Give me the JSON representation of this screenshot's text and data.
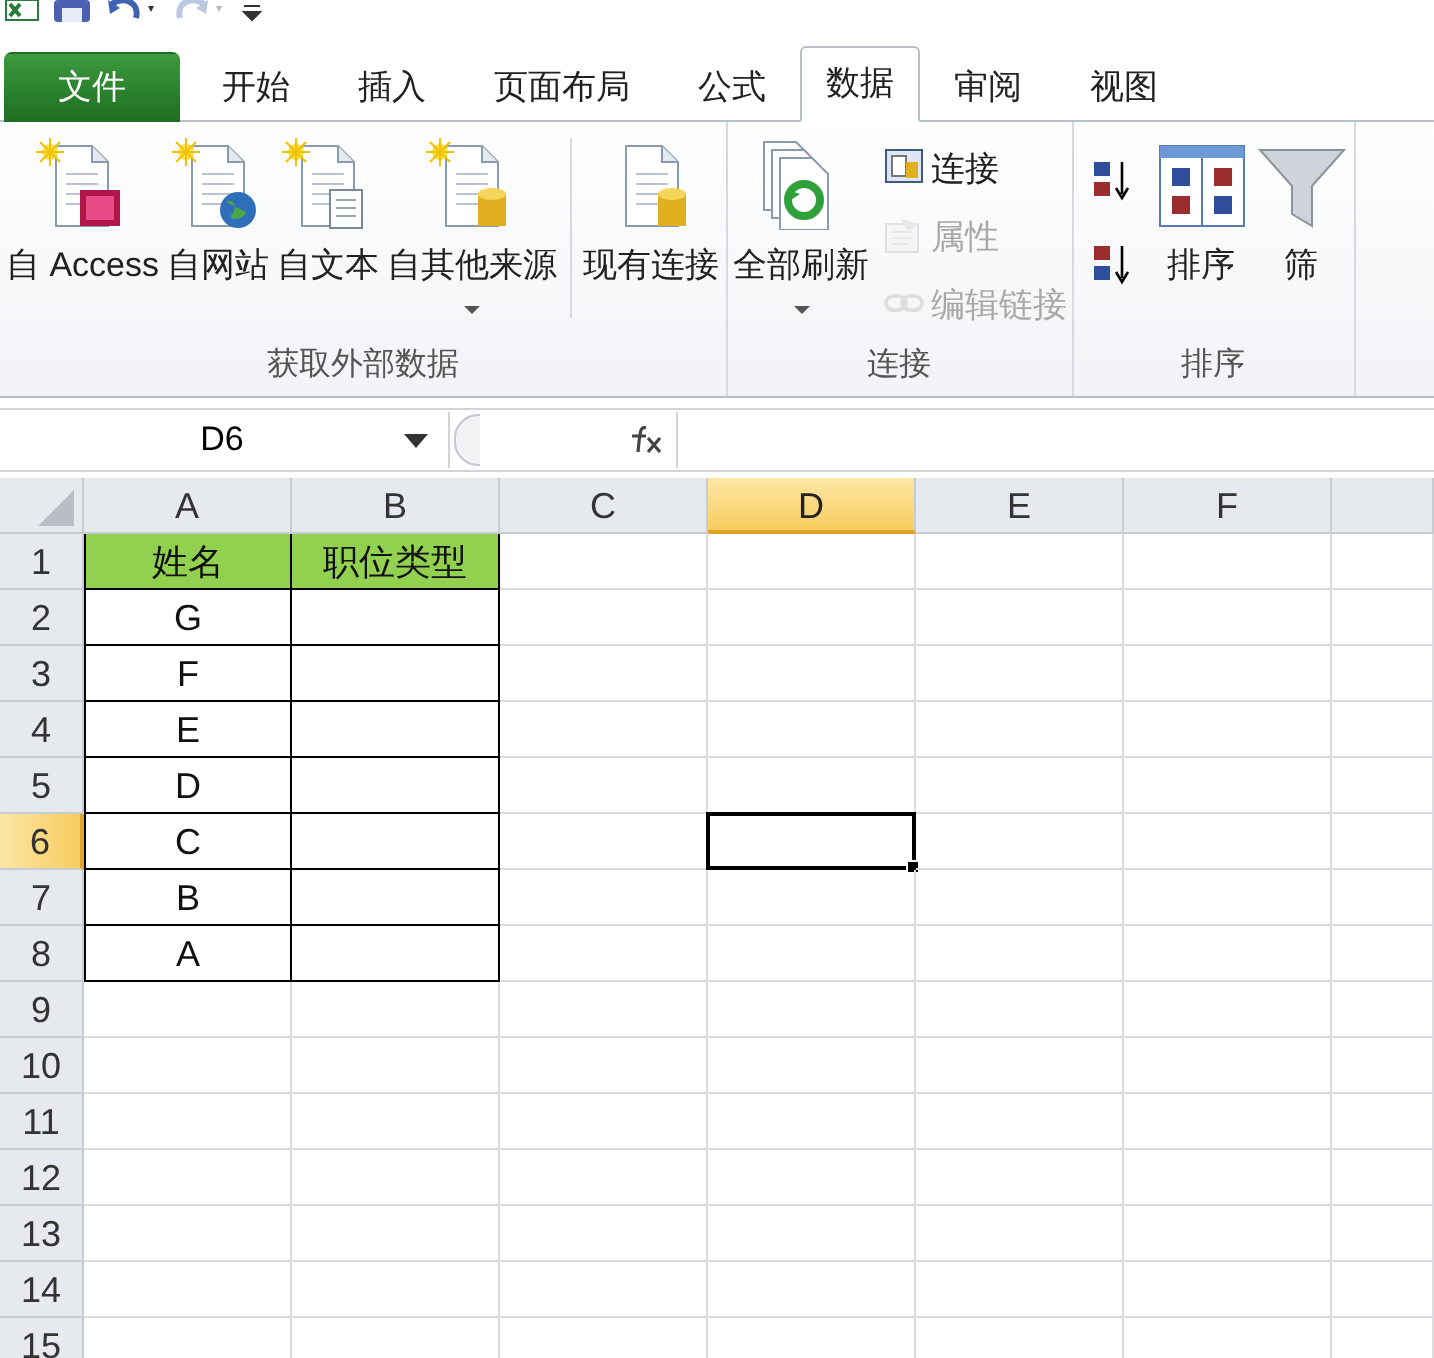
{
  "quick_access": [
    {
      "kind": "app",
      "disabled": false
    },
    {
      "kind": "save",
      "disabled": false
    },
    {
      "kind": "undo",
      "disabled": false
    },
    {
      "kind": "redo",
      "disabled": true
    },
    {
      "kind": "customize",
      "disabled": false
    }
  ],
  "tabs": [
    {
      "label": "文件",
      "kind": "file",
      "selected": false
    },
    {
      "label": "开始",
      "kind": "tab",
      "selected": false
    },
    {
      "label": "插入",
      "kind": "tab",
      "selected": false
    },
    {
      "label": "页面布局",
      "kind": "tab",
      "selected": false
    },
    {
      "label": "公式",
      "kind": "tab",
      "selected": false
    },
    {
      "label": "数据",
      "kind": "tab",
      "selected": true
    },
    {
      "label": "审阅",
      "kind": "tab",
      "selected": false
    },
    {
      "label": "视图",
      "kind": "tab",
      "selected": false
    }
  ],
  "ribbon": [
    {
      "label": "获取外部数据",
      "buttons": [
        {
          "kind": "large",
          "label": "自 Access",
          "dropdown": false,
          "disabled": false
        },
        {
          "kind": "large",
          "label": "自网站",
          "dropdown": false,
          "disabled": false
        },
        {
          "kind": "large",
          "label": "自文本",
          "dropdown": false,
          "disabled": false
        },
        {
          "kind": "large",
          "label": "自其他来源",
          "dropdown": true,
          "disabled": false
        },
        {
          "kind": "separator"
        },
        {
          "kind": "large",
          "label": "现有连接",
          "dropdown": false,
          "disabled": false
        }
      ]
    },
    {
      "label": "连接",
      "buttons": [
        {
          "kind": "large",
          "label": "全部刷新",
          "dropdown": true,
          "disabled": false
        },
        {
          "kind": "small",
          "label": "连接",
          "disabled": false
        },
        {
          "kind": "small",
          "label": "属性",
          "disabled": true
        },
        {
          "kind": "small",
          "label": "编辑链接",
          "disabled": true
        }
      ]
    },
    {
      "label": "排序",
      "buttons": [
        {
          "kind": "icon",
          "disabled": false
        },
        {
          "kind": "icon",
          "disabled": false
        },
        {
          "kind": "large",
          "label": "排序",
          "dropdown": false,
          "disabled": false
        },
        {
          "kind": "large",
          "label": "筛",
          "dropdown": false,
          "disabled": false
        }
      ]
    }
  ],
  "formula_bar": {
    "name_box": "D6"
  },
  "sheet": {
    "columns": [
      {
        "label": "A",
        "selected": false
      },
      {
        "label": "B",
        "selected": false
      },
      {
        "label": "C",
        "selected": false
      },
      {
        "label": "D",
        "selected": true
      },
      {
        "label": "E",
        "selected": false
      },
      {
        "label": "F",
        "selected": false
      }
    ],
    "rows": [
      {
        "label": "1",
        "selected": false,
        "kind": "header",
        "cells": [
          "姓名",
          "职位类型"
        ]
      },
      {
        "label": "2",
        "selected": false,
        "kind": "data",
        "cells": [
          "G",
          ""
        ]
      },
      {
        "label": "3",
        "selected": false,
        "kind": "data",
        "cells": [
          "F",
          ""
        ]
      },
      {
        "label": "4",
        "selected": false,
        "kind": "data",
        "cells": [
          "E",
          ""
        ]
      },
      {
        "label": "5",
        "selected": false,
        "kind": "data",
        "cells": [
          "D",
          ""
        ]
      },
      {
        "label": "6",
        "selected": true,
        "kind": "data",
        "cells": [
          "C",
          ""
        ]
      },
      {
        "label": "7",
        "selected": false,
        "kind": "data",
        "cells": [
          "B",
          ""
        ]
      },
      {
        "label": "8",
        "selected": false,
        "kind": "data",
        "cells": [
          "A",
          ""
        ]
      },
      {
        "label": "9",
        "selected": false
      },
      {
        "label": "10",
        "selected": false
      },
      {
        "label": "11",
        "selected": false
      },
      {
        "label": "12",
        "selected": false
      },
      {
        "label": "13",
        "selected": false
      },
      {
        "label": "14",
        "selected": false
      },
      {
        "label": "15",
        "selected": false
      }
    ]
  }
}
